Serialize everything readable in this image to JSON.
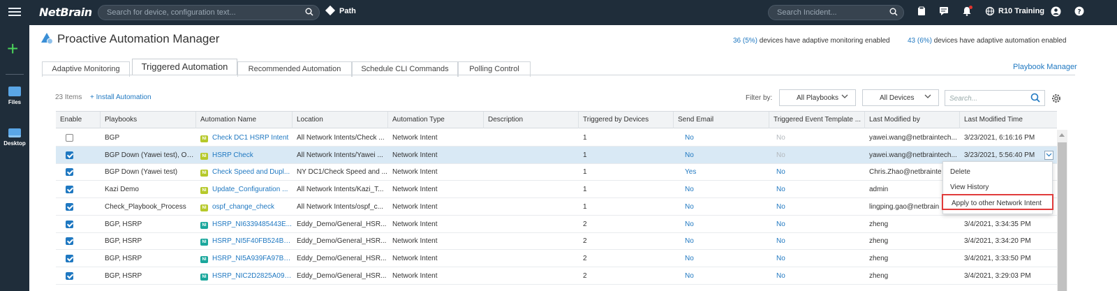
{
  "topbar": {
    "logo": "NetBrain",
    "search_placeholder": "Search for device, configuration text...",
    "path_label": "Path",
    "incident_placeholder": "Search Incident...",
    "domain_label": "R10 Training"
  },
  "rail": {
    "files_label": "Files",
    "desktop_label": "Desktop"
  },
  "page": {
    "title": "Proactive Automation Manager",
    "stat1_count": "36 (5%)",
    "stat1_text": " devices have adaptive monitoring enabled",
    "stat2_count": "43 (6%)",
    "stat2_text": " devices have adaptive automation enabled"
  },
  "tabs": [
    {
      "label": "Adaptive Monitoring"
    },
    {
      "label": "Triggered Automation"
    },
    {
      "label": "Recommended Automation"
    },
    {
      "label": "Schedule CLI Commands"
    },
    {
      "label": "Polling Control"
    }
  ],
  "playbook_manager": "Playbook Manager",
  "toolbar": {
    "items_count": "23 Items",
    "install": "+ Install Automation",
    "filter_label": "Filter by:",
    "playbooks_filter": "All Playbooks",
    "devices_filter": "All Devices",
    "search_placeholder": "Search..."
  },
  "table": {
    "columns": [
      "Enable",
      "Playbooks",
      "Automation Name",
      "Location",
      "Automation Type",
      "Description",
      "Triggered by Devices",
      "Send Email",
      "Triggered Event Template ...",
      "Last Modified by",
      "Last Modified Time"
    ],
    "rows": [
      {
        "enabled": false,
        "playbooks": "BGP",
        "ni_color": "yellow",
        "automation": "Check DC1 HSRP Intent",
        "location": "All Network Intents/Check ...",
        "type": "Network Intent",
        "description": "",
        "devices": "1",
        "email": "No",
        "template": "No",
        "modified_by": "yawei.wang@netbraintech...",
        "modified_time": "3/23/2021, 6:16:16 PM"
      },
      {
        "enabled": true,
        "playbooks": "BGP Down (Yawei test), OS...",
        "ni_color": "yellow",
        "automation": "HSRP Check",
        "location": "All Network Intents/Yawei ...",
        "type": "Network Intent",
        "description": "",
        "devices": "1",
        "email": "No",
        "template": "No",
        "modified_by": "yawei.wang@netbraintech...",
        "modified_time": "3/23/2021, 5:56:40 PM"
      },
      {
        "enabled": true,
        "playbooks": "BGP Down (Yawei test)",
        "ni_color": "yellow",
        "automation": "Check Speed and Dupl...",
        "location": "NY DC1/Check Speed and ...",
        "type": "Network Intent",
        "description": "",
        "devices": "1",
        "email": "Yes",
        "template": "No",
        "modified_by": "Chris.Zhao@netbrainte",
        "modified_time": ""
      },
      {
        "enabled": true,
        "playbooks": "Kazi Demo",
        "ni_color": "yellow",
        "automation": "Update_Configuration ...",
        "location": "All Network Intents/Kazi_T...",
        "type": "Network Intent",
        "description": "",
        "devices": "1",
        "email": "No",
        "template": "No",
        "modified_by": "admin",
        "modified_time": ""
      },
      {
        "enabled": true,
        "playbooks": "Check_Playbook_Process",
        "ni_color": "yellow",
        "automation": "ospf_change_check",
        "location": "All Network Intents/ospf_c...",
        "type": "Network Intent",
        "description": "",
        "devices": "1",
        "email": "No",
        "template": "No",
        "modified_by": "lingping.gao@netbrain",
        "modified_time": ""
      },
      {
        "enabled": true,
        "playbooks": "BGP, HSRP",
        "ni_color": "teal",
        "automation": "HSRP_NI6339485443E...",
        "location": "Eddy_Demo/General_HSR...",
        "type": "Network Intent",
        "description": "",
        "devices": "2",
        "email": "No",
        "template": "No",
        "modified_by": "zheng",
        "modified_time": "3/4/2021, 3:34:35 PM"
      },
      {
        "enabled": true,
        "playbooks": "BGP, HSRP",
        "ni_color": "teal",
        "automation": "HSRP_NI5F40FB524B2...",
        "location": "Eddy_Demo/General_HSR...",
        "type": "Network Intent",
        "description": "",
        "devices": "2",
        "email": "No",
        "template": "No",
        "modified_by": "zheng",
        "modified_time": "3/4/2021, 3:34:20 PM"
      },
      {
        "enabled": true,
        "playbooks": "BGP, HSRP",
        "ni_color": "teal",
        "automation": "HSRP_NI5A939FA97BA...",
        "location": "Eddy_Demo/General_HSR...",
        "type": "Network Intent",
        "description": "",
        "devices": "2",
        "email": "No",
        "template": "No",
        "modified_by": "zheng",
        "modified_time": "3/4/2021, 3:33:50 PM"
      },
      {
        "enabled": true,
        "playbooks": "BGP, HSRP",
        "ni_color": "teal",
        "automation": "HSRP_NIC2D2825A094...",
        "location": "Eddy_Demo/General_HSR...",
        "type": "Network Intent",
        "description": "",
        "devices": "2",
        "email": "No",
        "template": "No",
        "modified_by": "zheng",
        "modified_time": "3/4/2021, 3:29:03 PM"
      }
    ]
  },
  "context_menu": {
    "items": [
      "Delete",
      "View History",
      "Apply to other Network Intent"
    ]
  }
}
